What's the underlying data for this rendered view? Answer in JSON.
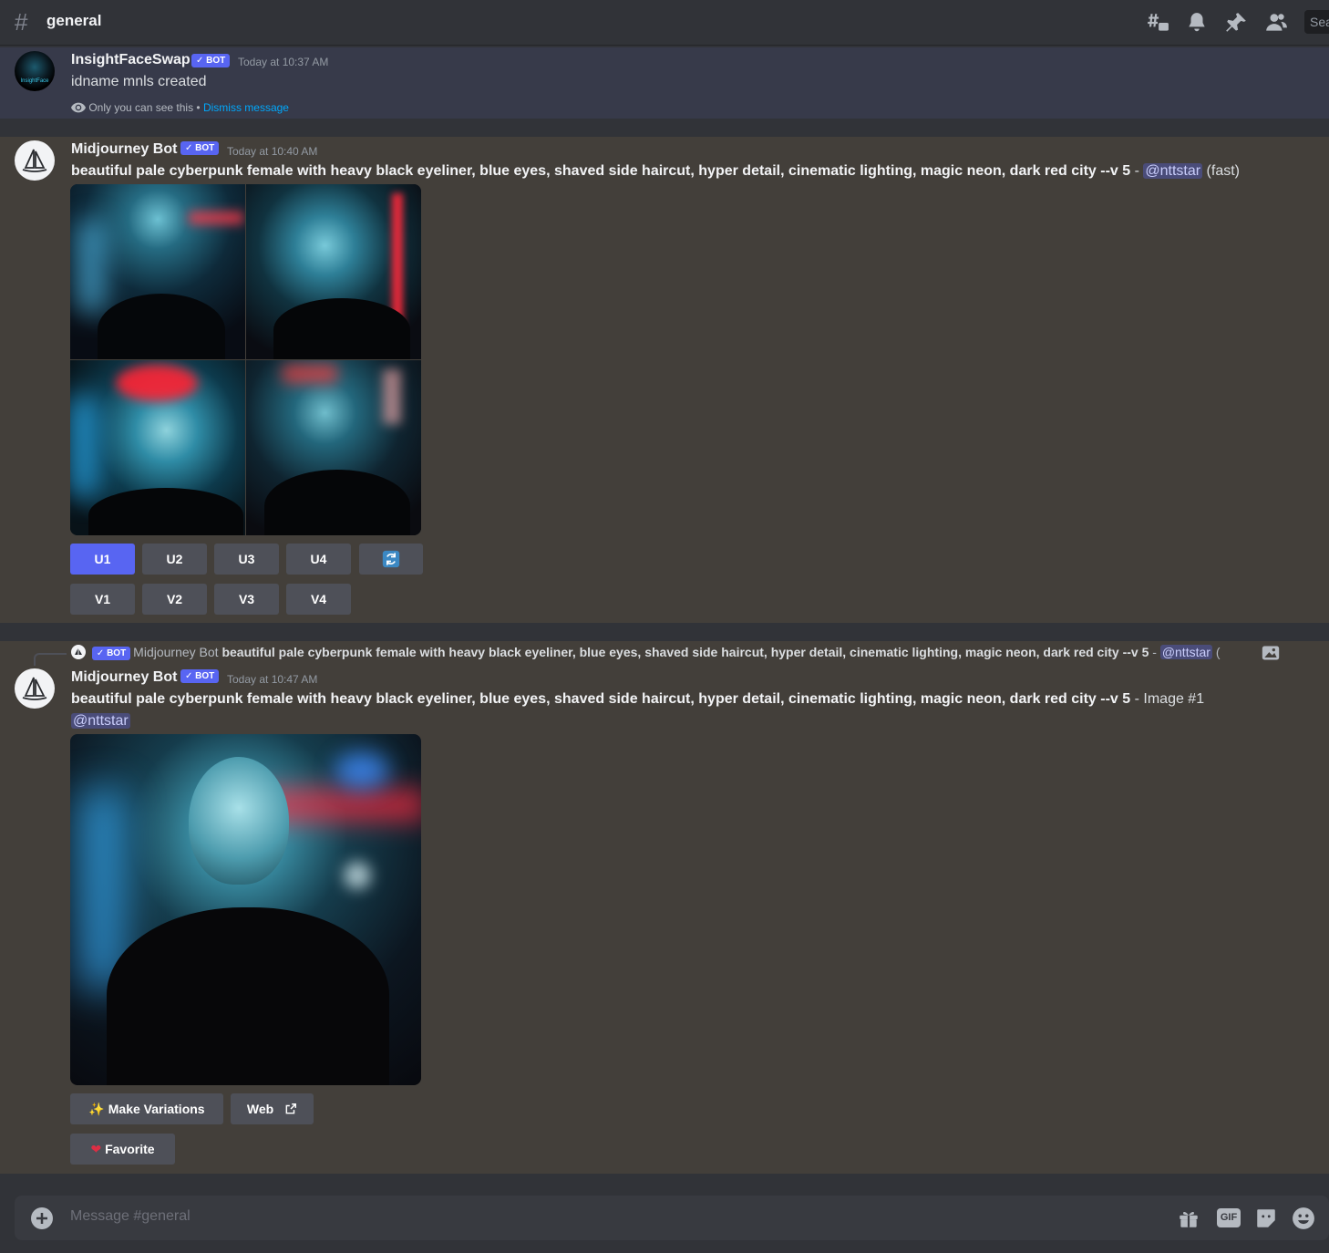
{
  "header": {
    "channel_name": "general",
    "search_placeholder": "Sea",
    "icons": [
      "threads-icon",
      "bell-icon",
      "pin-icon",
      "members-icon"
    ]
  },
  "messages": [
    {
      "author": "InsightFaceSwap",
      "avatar_text": "InsightFace",
      "badge": "BOT",
      "timestamp": "Today at 10:37 AM",
      "text": "idname mnls created",
      "ephemeral_note": "Only you can see this",
      "separator": " • ",
      "dismiss_label": "Dismiss message"
    },
    {
      "author": "Midjourney Bot",
      "badge": "BOT",
      "timestamp": "Today at 10:40 AM",
      "prompt": "beautiful pale cyberpunk female with heavy black eyeliner, blue eyes, shaved side haircut, hyper detail, cinematic lighting, magic neon, dark red city --v 5",
      "dash": " - ",
      "mention": "@nttstar",
      "suffix": " (fast)",
      "buttons_row1": [
        "U1",
        "U2",
        "U3",
        "U4"
      ],
      "buttons_row2": [
        "V1",
        "V2",
        "V3",
        "V4"
      ],
      "selected_button": "U1",
      "reroll_icon": "refresh-icon"
    },
    {
      "reply": {
        "badge": "BOT",
        "author": "Midjourney Bot",
        "prompt": "beautiful pale cyberpunk female with heavy black eyeliner, blue eyes, shaved side haircut, hyper detail, cinematic lighting, magic neon, dark red city --v 5",
        "dash": " - ",
        "mention": "@nttstar",
        "trail": " (",
        "image_icon": "image-icon"
      },
      "author": "Midjourney Bot",
      "badge": "BOT",
      "timestamp": "Today at 10:47 AM",
      "prompt": "beautiful pale cyberpunk female with heavy black eyeliner, blue eyes, shaved side haircut, hyper detail, cinematic lighting, magic neon, dark red city --v 5",
      "suffix": " - Image #1",
      "mention": "@nttstar",
      "make_variations_label": "Make Variations",
      "web_label": "Web",
      "favorite_label": "Favorite"
    }
  ],
  "composer": {
    "placeholder": "Message #general",
    "icons": [
      "gift-icon",
      "gif-icon",
      "sticker-icon",
      "emoji-icon"
    ],
    "gif_label": "GIF"
  },
  "colors": {
    "background": "#313338",
    "ephemeral_bg": "#373a4a",
    "highlight_bg": "#433f3a",
    "blurple": "#5865f2",
    "link": "#00a8fc"
  }
}
